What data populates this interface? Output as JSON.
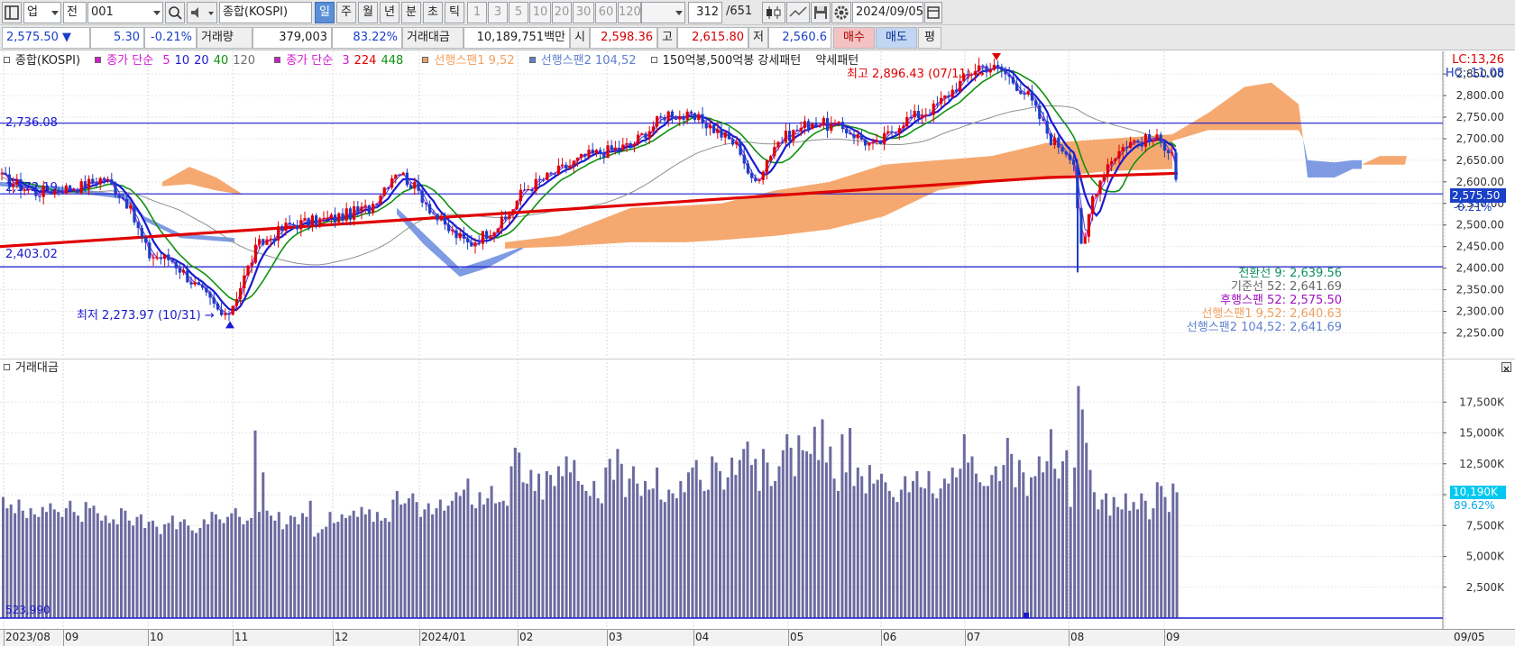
{
  "toolbar": {
    "type_label": "업",
    "all_label": "전",
    "code": "001",
    "index_name": "종합(KOSPI)",
    "periods": [
      "일",
      "주",
      "월",
      "년",
      "분",
      "초",
      "틱"
    ],
    "active_period": "일",
    "intervals": [
      "1",
      "3",
      "5",
      "10",
      "20",
      "30",
      "60",
      "120"
    ],
    "count_current": "312",
    "count_total": "/651",
    "date": "2024/09/05"
  },
  "quote": {
    "price": "2,575.50",
    "change": "5.30",
    "change_pct": "-0.21%",
    "volume_label": "거래량",
    "volume": "379,003",
    "volume_pct": "83.22%",
    "amount_label": "거래대금",
    "amount": "10,189,751백만",
    "open_label": "시",
    "open": "2,598.36",
    "high_label": "고",
    "high": "2,615.80",
    "low_label": "저",
    "low": "2,560.6",
    "buy_label": "매수",
    "sell_label": "매도",
    "avg_label": "평"
  },
  "legend": {
    "index": "종합(KOSPI)",
    "ma_label": "종가 단순",
    "ma_periods": [
      "5",
      "10",
      "20",
      "40",
      "120"
    ],
    "ma_colors": [
      "#d01ad0",
      "#1a1ad0",
      "#1a1ad0",
      "#109010",
      "#707070"
    ],
    "ma2_label": "종가 단순",
    "ma2_periods": [
      "3",
      "224",
      "448"
    ],
    "ma2_colors": [
      "#d01ad0",
      "#e00000",
      "#109010"
    ],
    "span1": "선행스팬1 9,52",
    "span2": "선행스팬2 104,52",
    "pattern": "150억봉,500억봉 강세패턴",
    "weak": "약세패턴",
    "volume_title": "거래대금"
  },
  "annotations": {
    "high": "최고 2,896.43 (07/11)",
    "low": "최저 2,273.97 (10/31)",
    "level_upper": "2,736.08",
    "level_mid": "2,572.19",
    "level_lower": "2,403.02",
    "vol_min": "523,990",
    "lc": "LC:13,26",
    "hc": "HC:-11,08",
    "current_price": "2,575.50",
    "current_pct": "-0.21%",
    "vol_current": "10,190K",
    "vol_pct": "89.62%"
  },
  "ichimoku": [
    {
      "text": "전환선 9: 2,639.56",
      "color": "#109060"
    },
    {
      "text": "기준선 52: 2,641.69",
      "color": "#666666"
    },
    {
      "text": "후행스팬 52: 2,575.50",
      "color": "#a010c0"
    },
    {
      "text": "선행스팬1 9,52: 2,640.63",
      "color": "#f0a060"
    },
    {
      "text": "선행스팬2 104,52: 2,641.69",
      "color": "#6080d0"
    }
  ],
  "x_ticks": [
    "2023/08",
    "09",
    "10",
    "11",
    "12",
    "2024/01",
    "02",
    "03",
    "04",
    "05",
    "06",
    "07",
    "08",
    "09"
  ],
  "x_right_label": "09/05",
  "colors": {
    "up": "#e00000",
    "down": "#1a3fc8",
    "cloud_bull": "#f4a060",
    "cloud_bear": "#7090e0",
    "volume_bar": "#6c6aa0",
    "ma224": "#e00000"
  },
  "chart_data": [
    {
      "type": "line",
      "title": "종합(KOSPI)",
      "y_ticks": [
        "2,850.00",
        "2,800.00",
        "2,750.00",
        "2,700.00",
        "2,650.00",
        "2,600.00",
        "2,550.00",
        "2,500.00",
        "2,450.00",
        "2,400.00",
        "2,350.00",
        "2,300.00",
        "2,250.00"
      ],
      "ylim": [
        2230,
        2890
      ],
      "x": [
        "2023/08",
        "09",
        "10",
        "11",
        "12",
        "2024/01",
        "02",
        "03",
        "04",
        "05",
        "06",
        "07",
        "08",
        "09"
      ],
      "series": [
        {
          "name": "close",
          "values": [
            2590,
            2560,
            2430,
            2310,
            2500,
            2540,
            2520,
            2650,
            2760,
            2740,
            2730,
            2850,
            2660,
            2680,
            2575
          ]
        },
        {
          "name": "224",
          "values": [
            2450,
            2470,
            2490,
            2510,
            2530,
            2550,
            2570,
            2590,
            2610,
            2620
          ]
        }
      ],
      "levels": [
        2736.08,
        2572.19,
        2403.02
      ],
      "high": 2896.43,
      "low": 2273.97
    },
    {
      "type": "bar",
      "title": "거래대금",
      "y_ticks": [
        "17,500K",
        "15,000K",
        "12,500K",
        "10,000K",
        "7,500K",
        "5,000K",
        "2,500K"
      ],
      "ylim": [
        0,
        20000
      ],
      "values": [
        9800,
        8900,
        9200,
        8500,
        9600,
        8700,
        8100,
        8900,
        8400,
        8200,
        9000,
        8600,
        9300,
        8800,
        8600,
        8200,
        8900,
        9500,
        8600,
        8300,
        7800,
        9400,
        8900,
        9100,
        8500,
        7900,
        8300,
        7700,
        8000,
        7600,
        8900,
        8700,
        7900,
        7500,
        8200,
        8400,
        7300,
        7800,
        7900,
        7400,
        6800,
        7600,
        7700,
        8300,
        7200,
        7800,
        8000,
        7500,
        7100,
        6900,
        7300,
        8000,
        7600,
        8600,
        8400,
        8000,
        7700,
        8200,
        8500,
        8900,
        8200,
        7600,
        7900,
        8100,
        15200,
        8600,
        11800,
        8700,
        8300,
        7900,
        8600,
        7200,
        7600,
        8300,
        8200,
        7600,
        8500,
        8200,
        9500,
        6600,
        6900,
        7200,
        7400,
        8600,
        7700,
        7800,
        8400,
        8100,
        8300,
        8700,
        8200,
        9000,
        8400,
        8800,
        7800,
        8600,
        7900,
        8100,
        7800,
        9600,
        10300,
        9200,
        9300,
        9700,
        10100,
        9400,
        8200,
        8800,
        9300,
        8400,
        8900,
        9600,
        8700,
        9100,
        9500,
        10200,
        9900,
        10400,
        11300,
        9200,
        8900,
        10200,
        9200,
        9700,
        10700,
        9300,
        9400,
        9500,
        9100,
        12300,
        13800,
        13400,
        11000,
        10900,
        12000,
        10300,
        11700,
        9600,
        11900,
        11600,
        10700,
        12300,
        11500,
        13100,
        11800,
        12800,
        11100,
        10800,
        10300,
        9900,
        11100,
        9700,
        9300,
        12200,
        12900,
        11200,
        13700,
        12500,
        9800,
        11300,
        12300,
        10900,
        9900,
        11100,
        10400,
        10500,
        12200,
        9600,
        9400,
        10400,
        10100,
        9700,
        11100,
        10200,
        11800,
        12200,
        12800,
        11200,
        10300,
        10400,
        13100,
        12600,
        11900,
        10400,
        11400,
        13000,
        11600,
        12800,
        13700,
        14300,
        12400,
        12900,
        10300,
        13700,
        12600,
        10700,
        11100,
        12300,
        13600,
        14900,
        13800,
        11500,
        14800,
        13600,
        13500,
        13300,
        15500,
        12800,
        16100,
        12600,
        13900,
        11300,
        10300,
        14900,
        11800,
        15400,
        10700,
        12200,
        11500,
        10100,
        12400,
        10900,
        11200,
        11700,
        11000,
        10300,
        9800,
        9400,
        10400,
        11500,
        10200,
        11100,
        11900,
        10600,
        10500,
        11900,
        10100,
        9700,
        10500,
        11300,
        10900,
        12200,
        11400,
        12100,
        14900,
        12600,
        13100,
        11700,
        11000,
        10700,
        10700,
        11600,
        12300,
        11100,
        12400,
        14600,
        13300,
        10600,
        12800,
        11800,
        9900,
        11400,
        11500,
        13100,
        11800,
        12700,
        15300,
        12100,
        11300,
        12700,
        13600,
        9000,
        12200,
        18800,
        16900,
        14200,
        12000,
        10200,
        8800,
        9600,
        10100,
        8300,
        9800,
        9000,
        8800,
        10100,
        8700,
        9400,
        8800,
        10100,
        9500,
        8000,
        8900,
        11000,
        10700,
        9800,
        8600,
        10900,
        10190
      ],
      "vol_min": 523990
    }
  ]
}
